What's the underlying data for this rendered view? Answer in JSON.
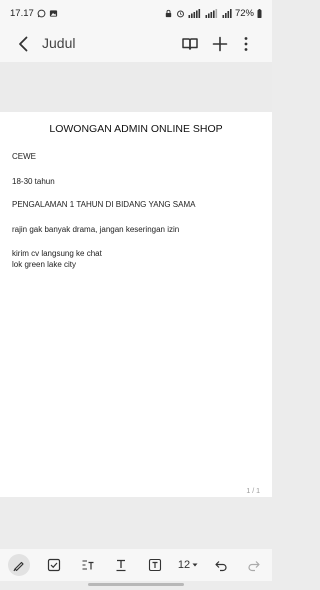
{
  "status_bar": {
    "time": "17.17",
    "battery": "72%"
  },
  "app_bar": {
    "title": "Judul"
  },
  "document": {
    "title": "LOWONGAN ADMIN ONLINE SHOP",
    "lines": [
      "CEWE",
      "18-30 tahun",
      "PENGALAMAN 1 TAHUN DI BIDANG YANG SAMA",
      "rajin gak banyak drama, jangan keseringan izin",
      "kirim cv langsung ke chat",
      "lok green lake city"
    ],
    "page_indicator": "1 / 1"
  },
  "toolbar": {
    "font_size": "12",
    "icons": [
      "pen-icon",
      "checkbox-icon",
      "text-style-icon",
      "text-format-icon",
      "text-box-icon",
      "font-size-dropdown",
      "undo-icon",
      "redo-icon"
    ]
  }
}
